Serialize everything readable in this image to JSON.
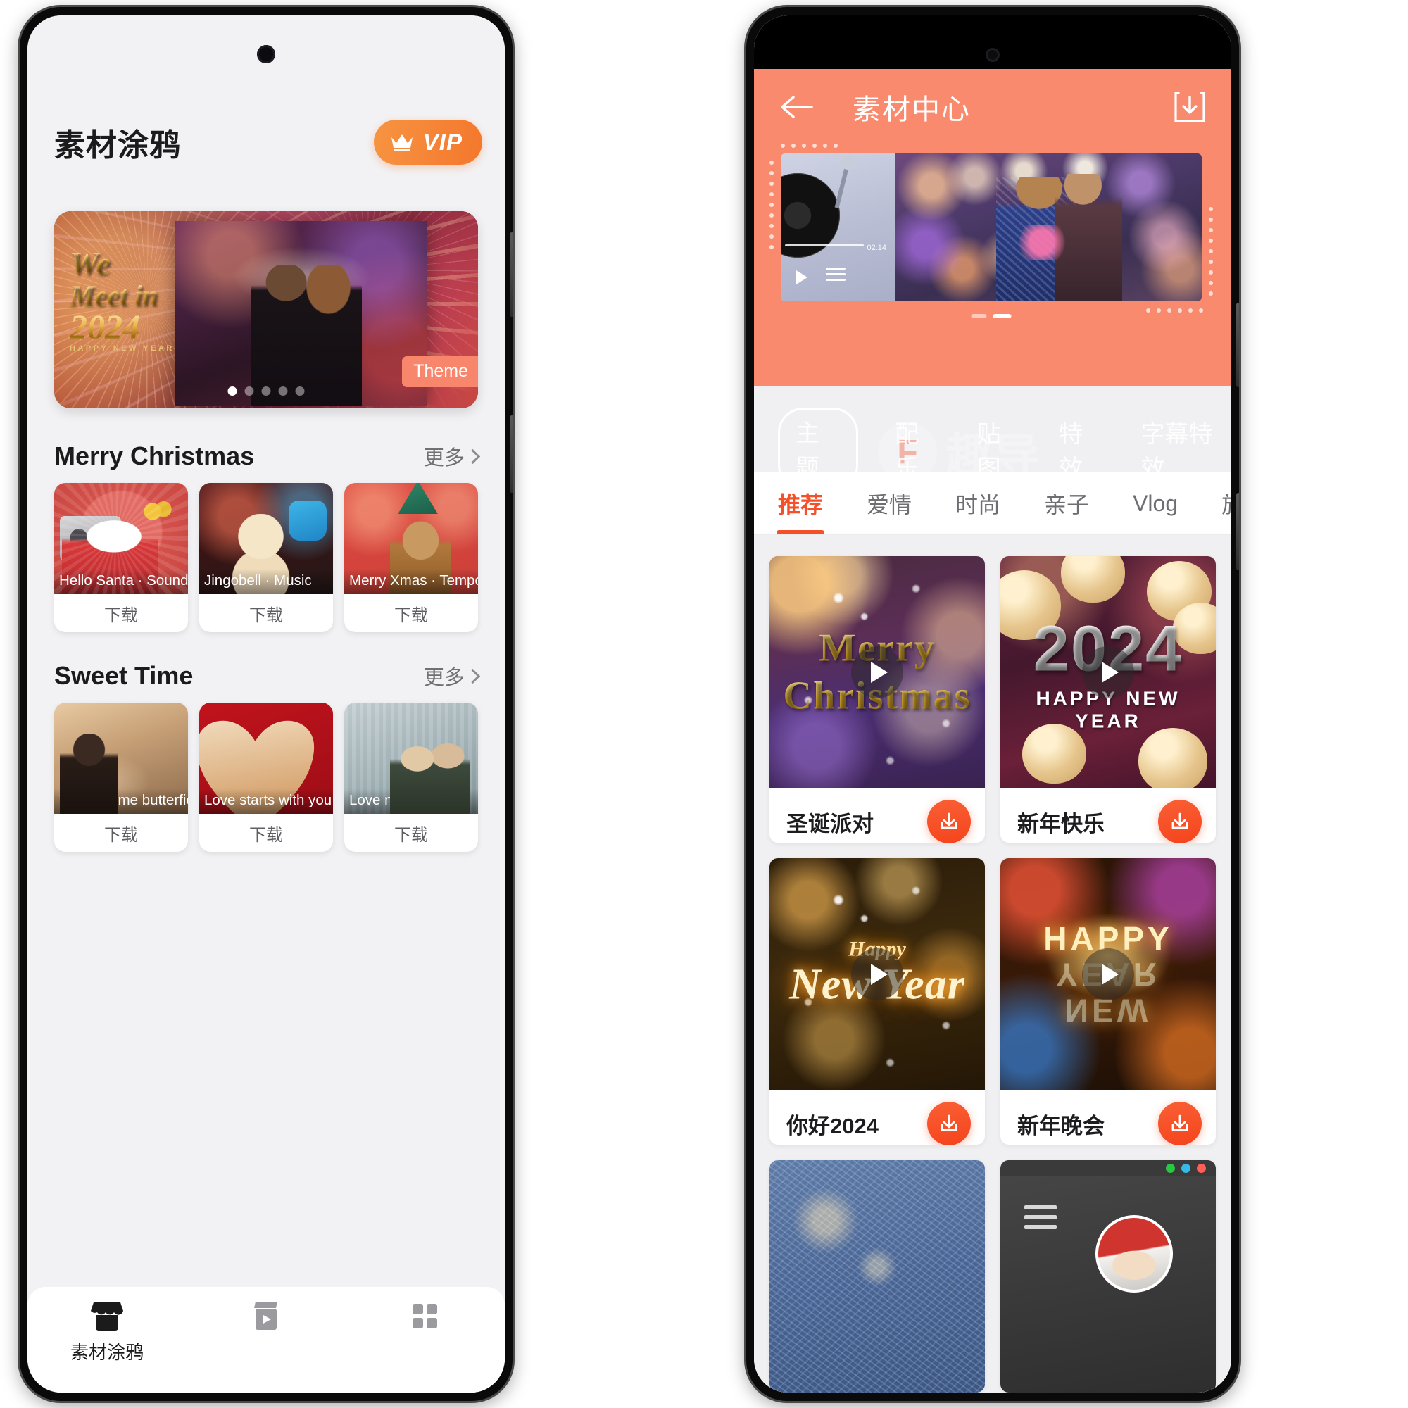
{
  "theme": {
    "coral": "#f98a6e",
    "orange_accent": "#f4502a",
    "vip_gradient_start": "#f79442",
    "vip_gradient_end": "#f4772c",
    "download_button": "#f4441c"
  },
  "left_phone": {
    "page_title": "素材涂鸦",
    "vip_label": "VIP",
    "banner": {
      "line1": "We",
      "line2": "Meet in",
      "line3": "2024",
      "line4": "HAPPY NEW YEAR",
      "badge": "Theme",
      "dot_count": 5,
      "active_dot": 1
    },
    "sections": [
      {
        "title": "Merry Christmas",
        "more_label": "更多",
        "cards": [
          {
            "caption": "Hello Santa · Sound",
            "action": "下载"
          },
          {
            "caption": "Jingobell · Music",
            "action": "下载"
          },
          {
            "caption": "Merry Xmas · Tempo",
            "action": "下载"
          }
        ]
      },
      {
        "title": "Sweet Time",
        "more_label": "更多",
        "cards": [
          {
            "caption": "You give me butterfies.",
            "action": "下载"
          },
          {
            "caption": "Love  starts with you.",
            "action": "下载"
          },
          {
            "caption": "Love never dies.",
            "action": "下载"
          }
        ]
      }
    ],
    "bottom_nav": [
      {
        "icon": "store-icon",
        "label": "素材涂鸦",
        "active": true
      },
      {
        "icon": "clapperboard-icon",
        "label": "",
        "active": false
      },
      {
        "icon": "grid-icon",
        "label": "",
        "active": false
      }
    ]
  },
  "right_phone": {
    "header": {
      "back_icon": "arrow-left-icon",
      "title": "素材中心",
      "download_icon": "download-box-icon"
    },
    "carousel": {
      "music_time": "02:14",
      "indicator_count": 2,
      "active_indicator": 2
    },
    "watermark": {
      "badge": "F",
      "text": "趣导"
    },
    "tabs": [
      {
        "label": "主题",
        "active": true
      },
      {
        "label": "配乐",
        "active": false
      },
      {
        "label": "贴图",
        "active": false
      },
      {
        "label": "特效",
        "active": false
      },
      {
        "label": "字幕特效",
        "active": false
      }
    ],
    "categories": [
      {
        "label": "推荐",
        "active": true
      },
      {
        "label": "爱情",
        "active": false
      },
      {
        "label": "时尚",
        "active": false
      },
      {
        "label": "亲子",
        "active": false
      },
      {
        "label": "Vlog",
        "active": false
      },
      {
        "label": "旅行",
        "active": false
      }
    ],
    "items": [
      {
        "name": "圣诞派对",
        "art_text_1": "Merry",
        "art_text_2": "Christmas",
        "download_icon": "download-icon"
      },
      {
        "name": "新年快乐",
        "art_text_1": "2024",
        "art_text_2": "HAPPY NEW YEAR",
        "download_icon": "download-icon"
      },
      {
        "name": "你好2024",
        "art_text_1": "Happy",
        "art_text_2": "New Year",
        "download_icon": "download-icon"
      },
      {
        "name": "新年晚会",
        "art_text_1": "HAPPY",
        "art_text_2": "NEW YEAR",
        "download_icon": "download-icon"
      }
    ]
  }
}
